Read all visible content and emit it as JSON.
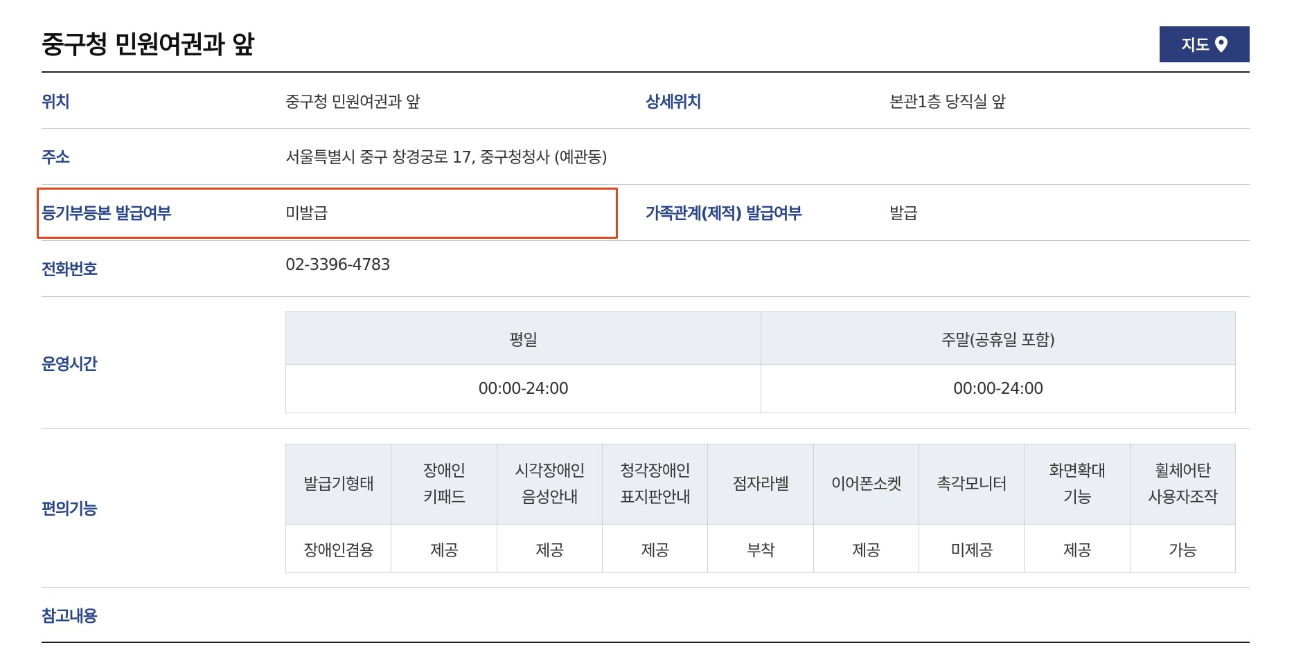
{
  "header": {
    "title": "중구청 민원여권과 앞",
    "map_button": "지도",
    "map_icon": "location-pin-icon"
  },
  "colors": {
    "label": "#27458f",
    "button_bg": "#2b3d7a",
    "highlight": "#e0471a",
    "table_header_bg": "#ebeef2"
  },
  "info": {
    "location_label": "위치",
    "location_value": "중구청 민원여권과 앞",
    "detail_label": "상세위치",
    "detail_value": "본관1층 당직실 앞",
    "address_label": "주소",
    "address_value": "서울특별시 중구 창경궁로 17, 중구청청사 (예관동)",
    "registry_label": "등기부등본 발급여부",
    "registry_value": "미발급",
    "family_label": "가족관계(제적) 발급여부",
    "family_value": "발급",
    "phone_label": "전화번호",
    "phone_value": "02-3396-4783",
    "hours_label": "운영시간",
    "convenience_label": "편의기능",
    "notes_label": "참고내용"
  },
  "hours": {
    "headers": [
      "평일",
      "주말(공휴일 포함)"
    ],
    "values": [
      "00:00-24:00",
      "00:00-24:00"
    ]
  },
  "convenience": {
    "headers": [
      [
        "발급기형태"
      ],
      [
        "장애인",
        "키패드"
      ],
      [
        "시각장애인",
        "음성안내"
      ],
      [
        "청각장애인",
        "표지판안내"
      ],
      [
        "점자라벨"
      ],
      [
        "이어폰소켓"
      ],
      [
        "촉각모니터"
      ],
      [
        "화면확대",
        "기능"
      ],
      [
        "휠체어탄",
        "사용자조작"
      ]
    ],
    "values": [
      "장애인겸용",
      "제공",
      "제공",
      "제공",
      "부착",
      "제공",
      "미제공",
      "제공",
      "가능"
    ]
  }
}
